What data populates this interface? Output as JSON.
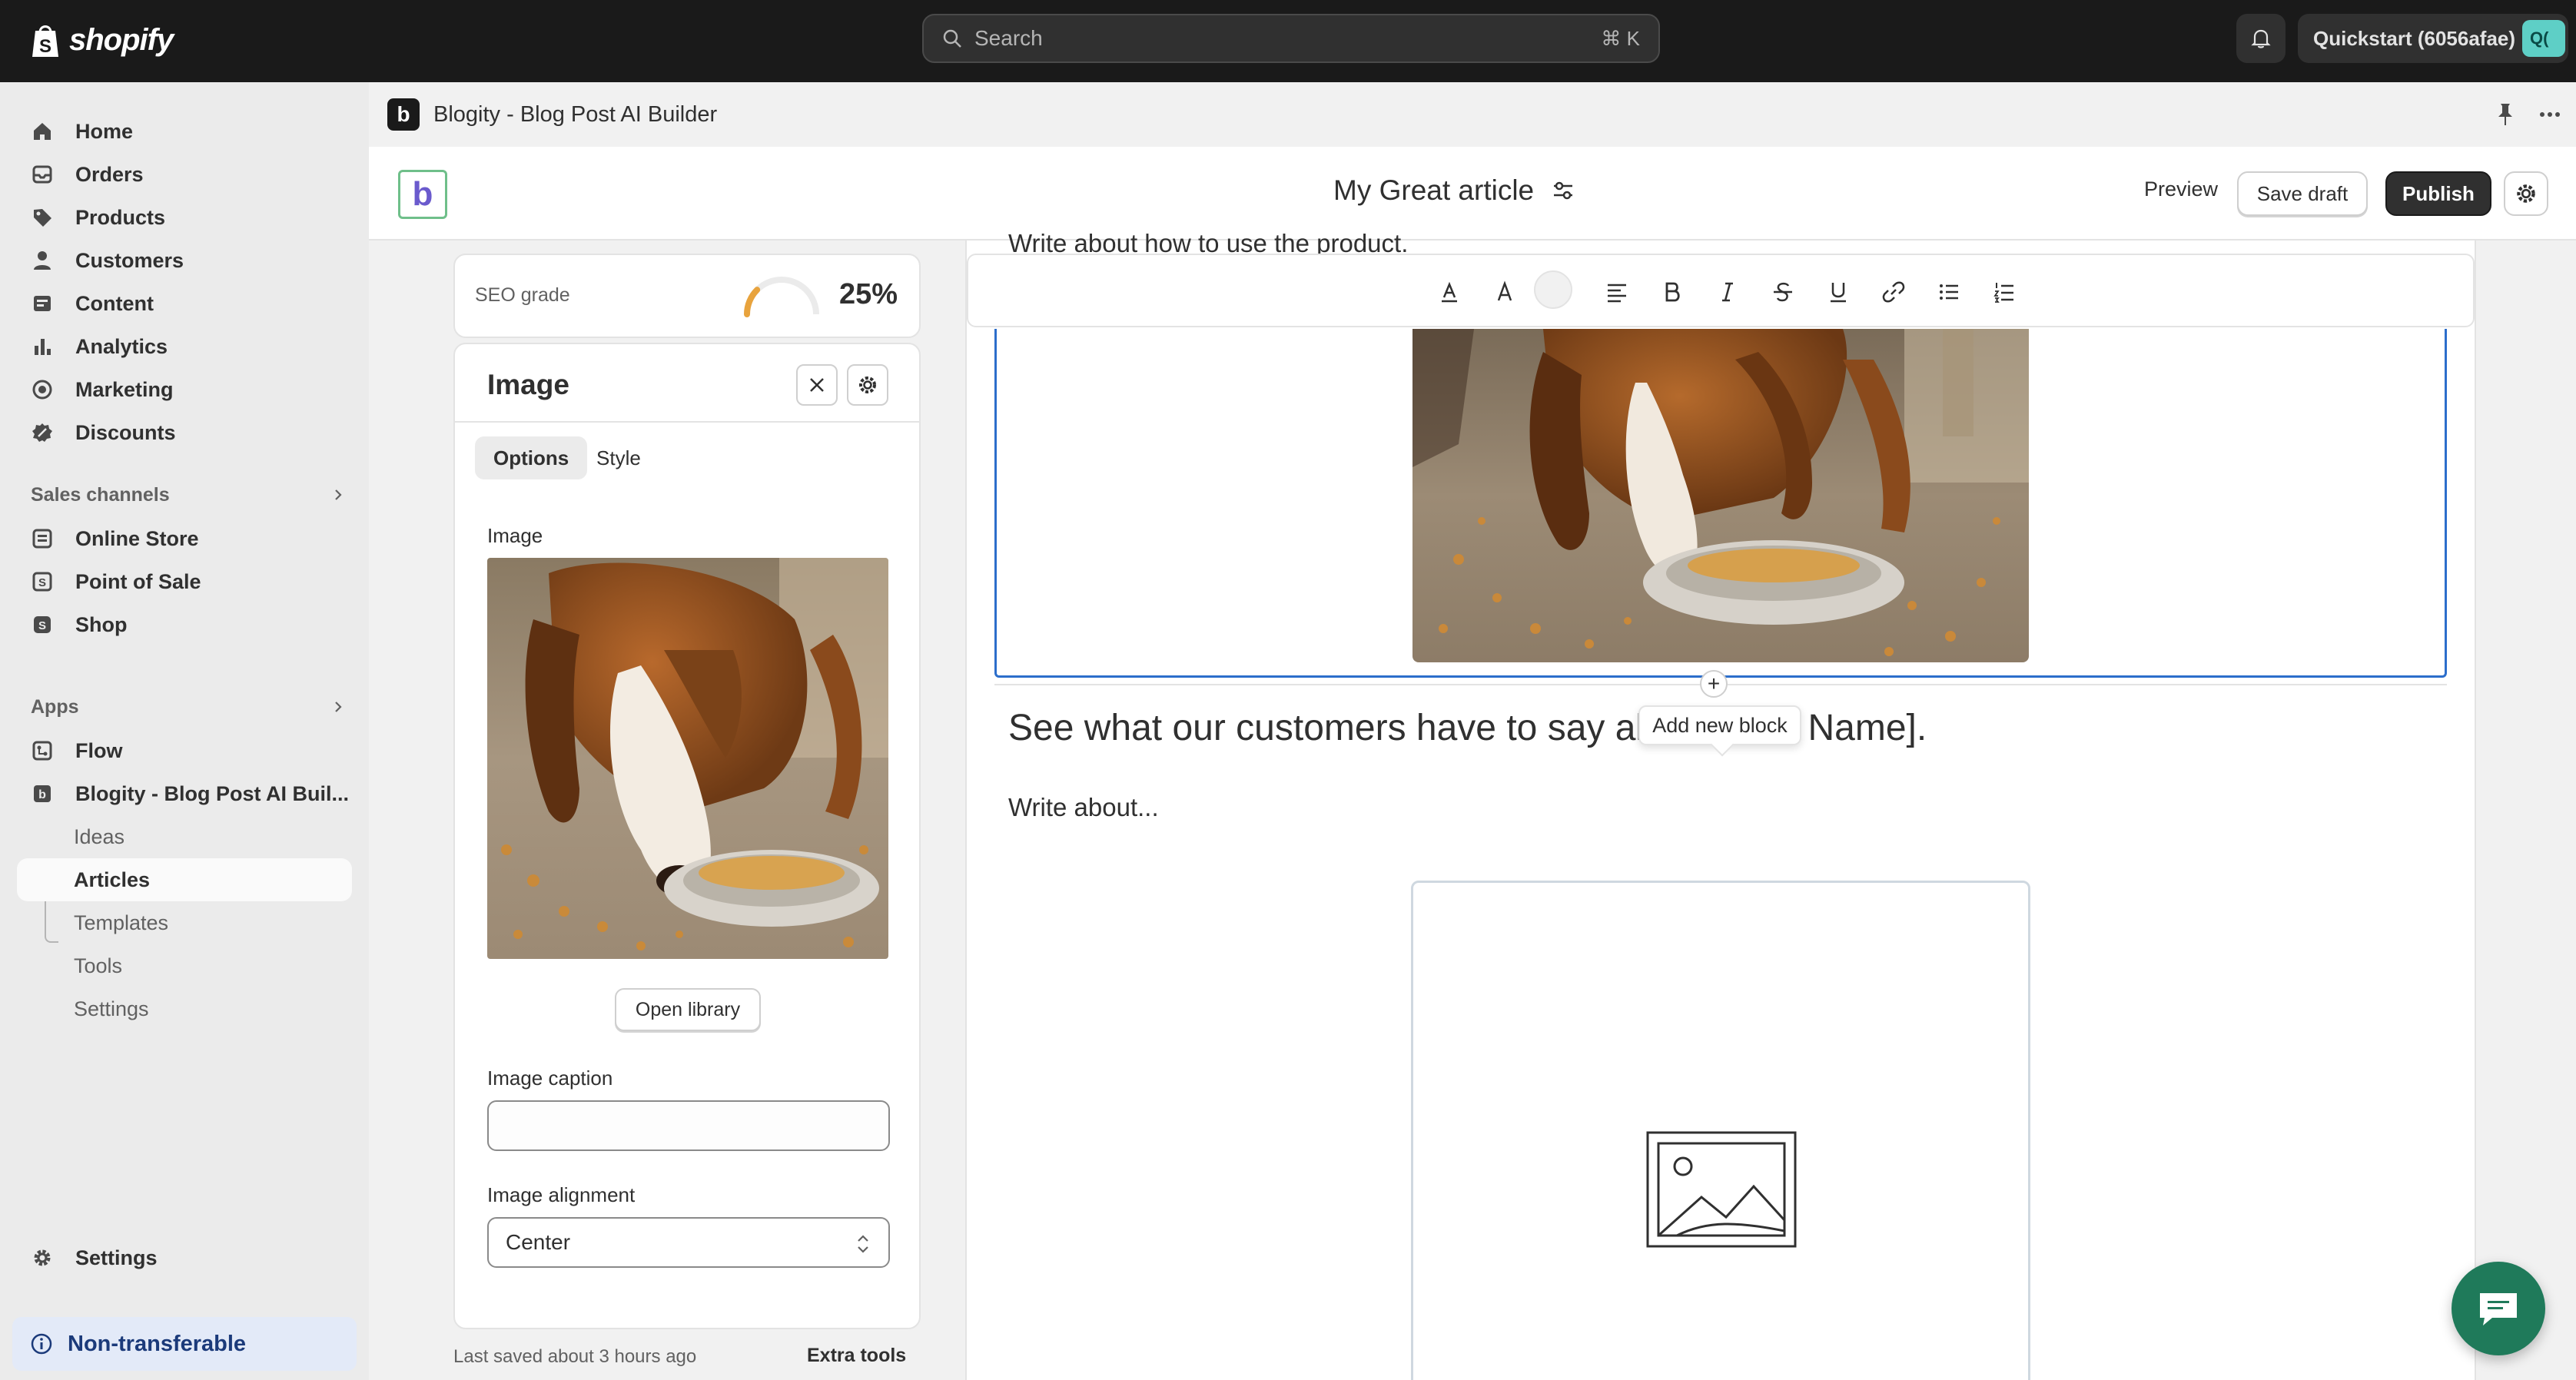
{
  "topbar": {
    "brand": "shopify",
    "search_placeholder": "Search",
    "search_shortcut": "⌘ K",
    "store_name": "Quickstart (6056afae)",
    "store_avatar": "Q("
  },
  "sidebar": {
    "main_items": [
      {
        "label": "Home",
        "icon": "home-icon"
      },
      {
        "label": "Orders",
        "icon": "orders-icon"
      },
      {
        "label": "Products",
        "icon": "tag-icon"
      },
      {
        "label": "Customers",
        "icon": "person-icon"
      },
      {
        "label": "Content",
        "icon": "content-icon"
      },
      {
        "label": "Analytics",
        "icon": "chart-icon"
      },
      {
        "label": "Marketing",
        "icon": "target-icon"
      },
      {
        "label": "Discounts",
        "icon": "discount-icon"
      }
    ],
    "sales_channels_label": "Sales channels",
    "sales_channels": [
      {
        "label": "Online Store",
        "icon": "store-icon"
      },
      {
        "label": "Point of Sale",
        "icon": "pos-icon"
      },
      {
        "label": "Shop",
        "icon": "shop-icon"
      }
    ],
    "apps_label": "Apps",
    "apps": [
      {
        "label": "Flow",
        "icon": "flow-icon"
      },
      {
        "label": "Blogity - Blog Post AI Buil...",
        "icon": "blogity-icon"
      }
    ],
    "app_subitems": [
      {
        "label": "Ideas"
      },
      {
        "label": "Articles"
      },
      {
        "label": "Templates"
      },
      {
        "label": "Tools"
      },
      {
        "label": "Settings"
      }
    ],
    "settings_label": "Settings",
    "non_transferable_label": "Non-transferable"
  },
  "appbar": {
    "badge": "b",
    "title": "Blogity - Blog Post AI Builder"
  },
  "editor": {
    "logo": "b",
    "doc_title": "My Great article",
    "preview_label": "Preview",
    "save_draft_label": "Save draft",
    "publish_label": "Publish"
  },
  "seo": {
    "label": "SEO grade",
    "value": "25%",
    "score": 0.25
  },
  "image_panel": {
    "title": "Image",
    "tabs": [
      {
        "label": "Options"
      },
      {
        "label": "Style"
      }
    ],
    "image_label": "Image",
    "open_library_label": "Open library",
    "caption_label": "Image caption",
    "caption_value": "",
    "alignment_label": "Image alignment",
    "alignment_value": "Center"
  },
  "footer": {
    "saved_note": "Last saved about 3 hours ago",
    "extra_tools_label": "Extra tools"
  },
  "canvas": {
    "cut_text": "Write about how to use the product.",
    "heading": "See what our customers have to say abo",
    "heading_tail": "ct Name].",
    "tooltip": "Add new block",
    "body_text": "Write about..."
  },
  "colors": {
    "topbar": "#1a1a1a",
    "accent_blue": "#2c6ecb",
    "publish": "#303030",
    "chat_fab": "#1f7a5a",
    "seo_gauge": "#e8a33d"
  }
}
